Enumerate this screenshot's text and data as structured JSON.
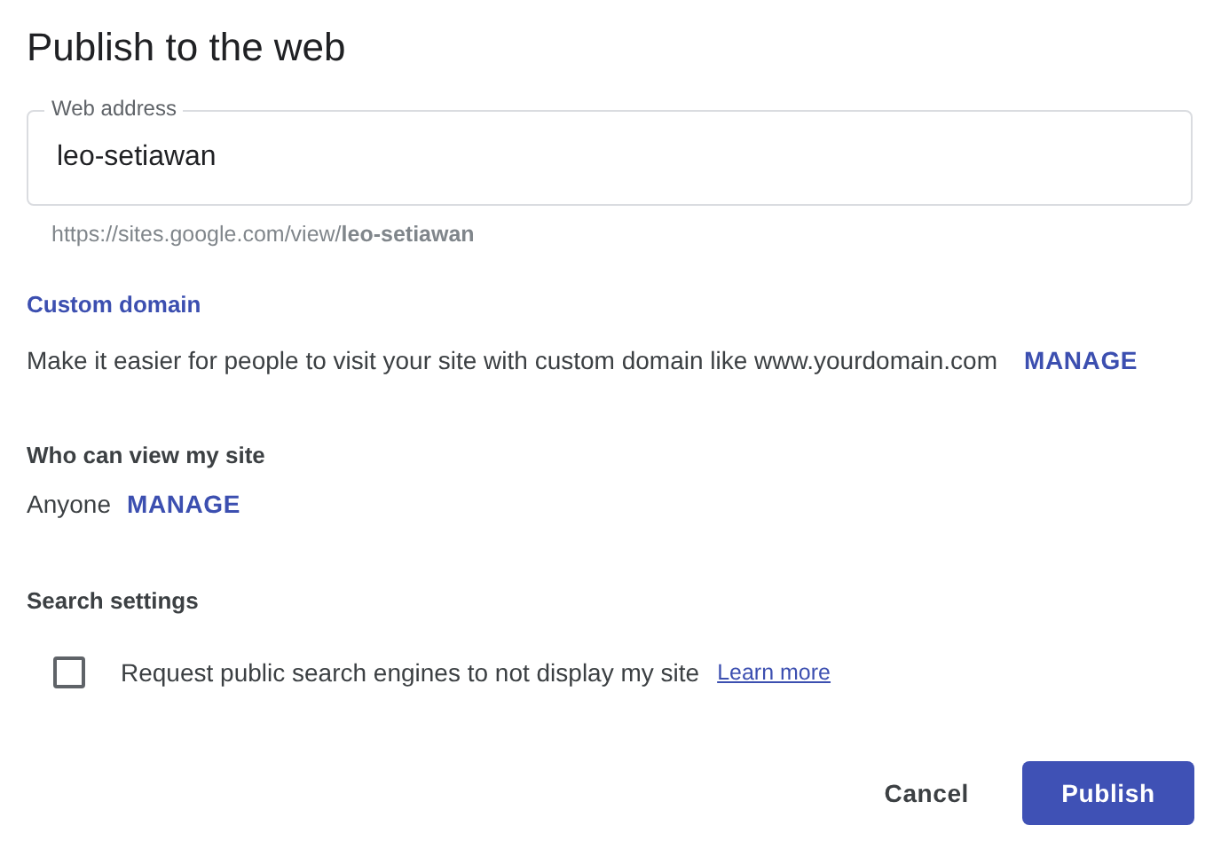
{
  "title": "Publish to the web",
  "web_address": {
    "label": "Web address",
    "value": "leo-setiawan",
    "url_hint": "https://sites.google.com/view/**leo-setiawan**"
  },
  "custom_domain": {
    "heading": "Custom domain",
    "text": "Make it easier for people to visit your site with custom domain like www.yourdomain.com",
    "action": "MANAGE"
  },
  "viewers": {
    "heading": "Who can view my site",
    "value": "Anyone",
    "action": "MANAGE"
  },
  "search_settings": {
    "heading": "Search settings",
    "option": {
      "label": "Request public search engines to not display my site",
      "checked": false
    },
    "link": "Learn more"
  },
  "buttons": [
    {
      "label": "Cancel",
      "kind": "text"
    },
    {
      "label": "Publish",
      "kind": "primary"
    }
  ]
}
